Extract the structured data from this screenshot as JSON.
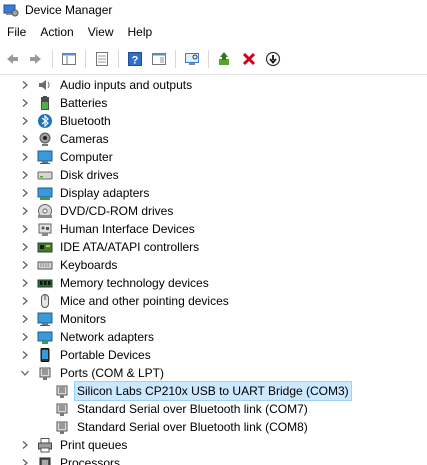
{
  "window": {
    "title": "Device Manager"
  },
  "menu": {
    "items": [
      "File",
      "Action",
      "View",
      "Help"
    ]
  },
  "toolbar": {
    "buttons": [
      "back-icon",
      "forward-icon",
      "properties-pane-icon",
      "properties-icon",
      "help-icon",
      "console-tree-icon",
      "scan-hardware-icon",
      "update-driver-icon",
      "uninstall-icon",
      "disable-icon"
    ]
  },
  "tree": {
    "categories": [
      {
        "label": "Audio inputs and outputs",
        "icon": "speaker-icon",
        "expanded": false
      },
      {
        "label": "Batteries",
        "icon": "battery-icon",
        "expanded": false
      },
      {
        "label": "Bluetooth",
        "icon": "bluetooth-icon",
        "expanded": false
      },
      {
        "label": "Cameras",
        "icon": "camera-icon",
        "expanded": false
      },
      {
        "label": "Computer",
        "icon": "monitor-icon",
        "expanded": false
      },
      {
        "label": "Disk drives",
        "icon": "disk-icon",
        "expanded": false
      },
      {
        "label": "Display adapters",
        "icon": "display-adapter-icon",
        "expanded": false
      },
      {
        "label": "DVD/CD-ROM drives",
        "icon": "dvd-icon",
        "expanded": false
      },
      {
        "label": "Human Interface Devices",
        "icon": "hid-icon",
        "expanded": false
      },
      {
        "label": "IDE ATA/ATAPI controllers",
        "icon": "ide-icon",
        "expanded": false
      },
      {
        "label": "Keyboards",
        "icon": "keyboard-icon",
        "expanded": false
      },
      {
        "label": "Memory technology devices",
        "icon": "memory-icon",
        "expanded": false
      },
      {
        "label": "Mice and other pointing devices",
        "icon": "mouse-icon",
        "expanded": false
      },
      {
        "label": "Monitors",
        "icon": "monitor-icon",
        "expanded": false
      },
      {
        "label": "Network adapters",
        "icon": "network-icon",
        "expanded": false
      },
      {
        "label": "Portable Devices",
        "icon": "portable-device-icon",
        "expanded": false
      },
      {
        "label": "Ports (COM & LPT)",
        "icon": "port-icon",
        "expanded": true
      }
    ],
    "ports_children": [
      {
        "label": "Silicon Labs CP210x USB to UART Bridge (COM3)",
        "icon": "port-icon",
        "selected": true
      },
      {
        "label": "Standard Serial over Bluetooth link (COM7)",
        "icon": "port-icon",
        "selected": false
      },
      {
        "label": "Standard Serial over Bluetooth link (COM8)",
        "icon": "port-icon",
        "selected": false
      }
    ],
    "after": [
      {
        "label": "Print queues",
        "icon": "printer-icon",
        "expanded": false
      },
      {
        "label": "Processors",
        "icon": "processor-icon",
        "expanded": false
      }
    ]
  },
  "colors": {
    "selection_bg": "#cce8ff",
    "selection_border": "#99d1ff",
    "accent_blue": "#1e73be",
    "uninstall_red": "#d0021b"
  }
}
